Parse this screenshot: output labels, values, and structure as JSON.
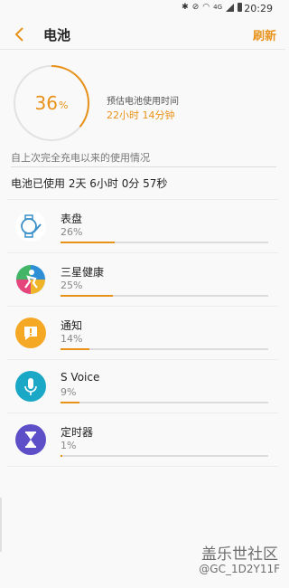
{
  "status_bar": {
    "time": "20:29",
    "network": "4G"
  },
  "header": {
    "title": "电池",
    "refresh_label": "刷新"
  },
  "battery": {
    "percent_number": "36",
    "percent_symbol": "%",
    "level": 0.36,
    "estimate_label": "预估电池使用时间",
    "estimate_value": "22小时 14分钟",
    "accent_color": "#e8921a"
  },
  "usage": {
    "section_title": "自上次完全充电以来的使用情况",
    "total": "电池已使用 2天 6小时 0分 57秒",
    "items": [
      {
        "name": "表盘",
        "percent": "26%",
        "value": 26,
        "icon": "watch-face-icon"
      },
      {
        "name": "三星健康",
        "percent": "25%",
        "value": 25,
        "icon": "samsung-health-icon"
      },
      {
        "name": "通知",
        "percent": "14%",
        "value": 14,
        "icon": "notification-icon"
      },
      {
        "name": "S Voice",
        "percent": "9%",
        "value": 9,
        "icon": "microphone-icon"
      },
      {
        "name": "定时器",
        "percent": "1%",
        "value": 1,
        "icon": "hourglass-icon"
      }
    ]
  },
  "watermark": {
    "brand": "盖乐世社区",
    "user": "@GC_1D2Y11F"
  }
}
